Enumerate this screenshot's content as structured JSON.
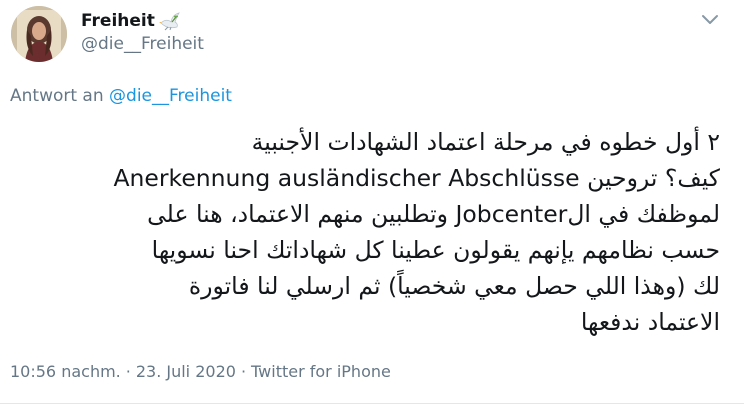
{
  "author": {
    "display_name": "Freiheit",
    "handle": "@die__Freiheit"
  },
  "reply": {
    "prefix": "Antwort an",
    "mention": "@die__Freiheit"
  },
  "tweet": {
    "lines": [
      "٢ أول خطوه في مرحلة اعتماد الشهادات الأجنبية",
      "كيف؟ تروحين Anerkennung ausländischer Abschlüsse",
      "لموظفك في الJobcenter وتطلبين منهم الاعتماد، هنا على",
      "حسب نظامهم يإنهم يقولون عطينا كل شهاداتك احنا نسويها",
      "لك (وهذا اللي حصل معي شخصياً) ثم ارسلي لنا فاتورة",
      "الاعتماد ندفعها"
    ]
  },
  "meta": {
    "time": "10:56 nachm.",
    "separator": "·",
    "date": "23. Juli 2020",
    "source": "Twitter for iPhone"
  },
  "icons": {
    "dove": "dove-emoji-icon",
    "more": "chevron-down-icon"
  },
  "colors": {
    "text": "#14171a",
    "secondary": "#657786",
    "link": "#1b95e0"
  }
}
